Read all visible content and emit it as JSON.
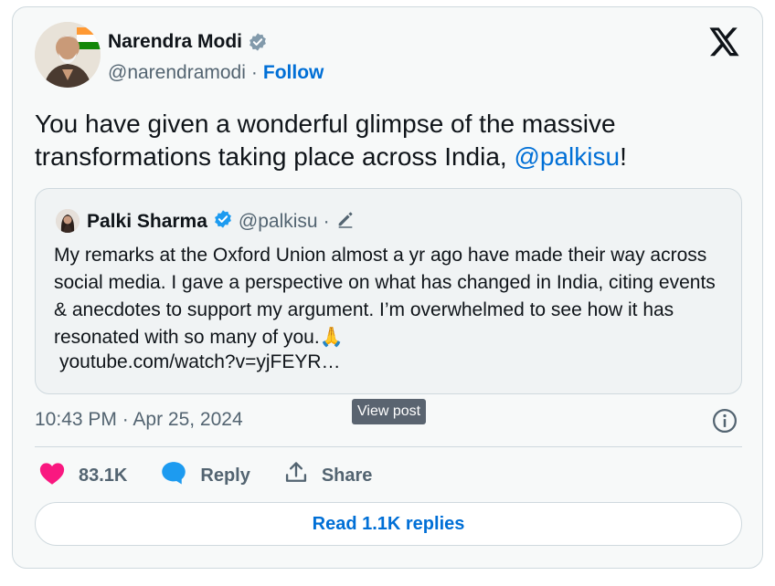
{
  "author": {
    "name": "Narendra Modi",
    "handle": "@narendramodi",
    "separator": "·",
    "follow_label": "Follow"
  },
  "tweet": {
    "text_before": "You have given a wonderful glimpse of the massive transformations taking place across India, ",
    "mention": "@palkisu",
    "text_after": "!"
  },
  "quote": {
    "name": "Palki Sharma",
    "handle": "@palkisu",
    "separator": "·",
    "text": "My remarks at the Oxford Union almost a yr ago have made their way across social media. I gave a perspective on what has changed in India, citing events & anecdotes to support my argument. I’m overwhelmed to see how it has resonated with so many of you.",
    "emoji": "🙏",
    "link": "youtube.com/watch?v=yjFEYR…"
  },
  "tooltip": {
    "label": "View post"
  },
  "timestamp": "10:43 PM · Apr 25, 2024",
  "actions": {
    "like_count": "83.1K",
    "reply_label": "Reply",
    "share_label": "Share"
  },
  "replies_button": {
    "label": "Read 1.1K replies"
  },
  "colors": {
    "accent": "#006fd6",
    "like": "#f91880",
    "text": "#0f1419",
    "muted": "#536471",
    "border": "#cfd9de"
  },
  "icons": {
    "verified_gray": "verified-badge-gray-icon",
    "verified_blue": "verified-badge-blue-icon",
    "x_logo": "x-logo-icon",
    "edit": "pencil-icon",
    "info": "info-icon",
    "like": "heart-icon",
    "reply": "speech-bubble-icon",
    "share": "share-icon"
  }
}
